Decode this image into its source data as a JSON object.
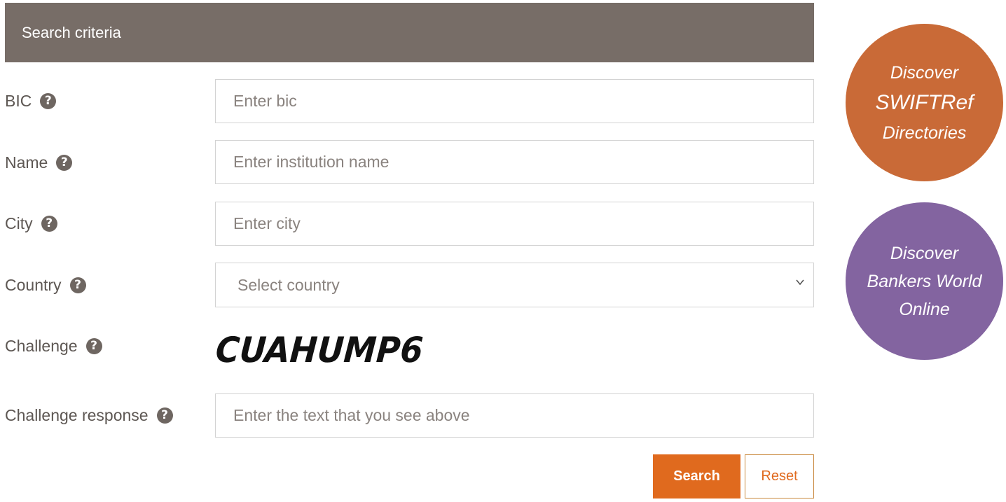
{
  "header": {
    "title": "Search criteria"
  },
  "form": {
    "bic": {
      "label": "BIC",
      "placeholder": "Enter bic"
    },
    "name": {
      "label": "Name",
      "placeholder": "Enter institution name"
    },
    "city": {
      "label": "City",
      "placeholder": "Enter city"
    },
    "country": {
      "label": "Country",
      "selected": "Select country"
    },
    "challenge": {
      "label": "Challenge",
      "captcha_text": "CUAHUMP6"
    },
    "challenge_response": {
      "label": "Challenge response",
      "placeholder": "Enter the text that you see above"
    },
    "help_glyph": "?"
  },
  "buttons": {
    "search": "Search",
    "reset": "Reset"
  },
  "promos": {
    "swiftref": {
      "line1": "Discover",
      "line2": "SWIFTRef",
      "line3": "Directories",
      "color": "#c96a37"
    },
    "bankers": {
      "line1": "Discover",
      "line2": "Bankers World",
      "line3": "Online",
      "color": "#8364a0"
    }
  },
  "colors": {
    "accent": "#e06a1e",
    "header_bg": "#776d67"
  }
}
